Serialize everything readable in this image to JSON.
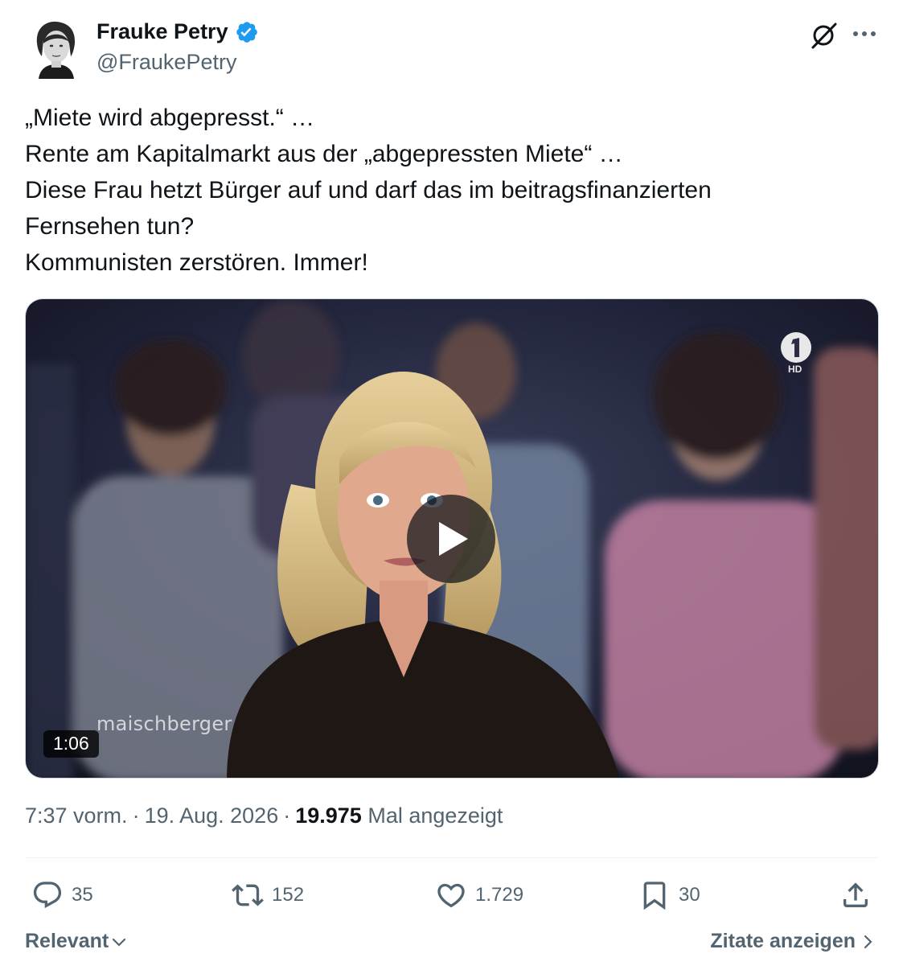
{
  "author": {
    "name": "Frauke Petry",
    "handle": "@FraukePetry",
    "verified": true,
    "verified_color": "#1d9bf0"
  },
  "tweet": {
    "lines": [
      "„Miete wird abgepresst.“ …",
      "Rente am Kapitalmarkt aus der „abgepressten Miete“ …",
      "Diese Frau hetzt Bürger auf und darf das im beitragsfinanzierten",
      "Fernsehen tun?",
      "Kommunisten zerstören. Immer!"
    ]
  },
  "media": {
    "type": "video",
    "duration": "1:06",
    "watermark": "maischberger",
    "channel_logo_text": "HD",
    "play_icon": "play-icon"
  },
  "meta": {
    "time": "7:37 vorm.",
    "separator": "·",
    "date": "19. Aug. 2026",
    "views": "19.975",
    "views_label": "Mal angezeigt"
  },
  "actions": {
    "replies": "35",
    "reposts": "152",
    "likes": "1.729",
    "bookmarks": "30"
  },
  "footer": {
    "sort_label": "Relevant",
    "quotes_label": "Zitate anzeigen"
  },
  "colors": {
    "text_primary": "#0f1419",
    "text_secondary": "#536471",
    "accent": "#1d9bf0",
    "divider": "#eff3f4"
  }
}
